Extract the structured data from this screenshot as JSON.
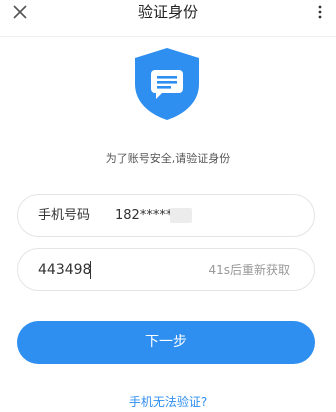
{
  "header": {
    "title": "验证身份",
    "close_icon": "close-icon",
    "more_icon": "more-vertical-icon"
  },
  "shield": {
    "icon": "shield-message-icon",
    "color": "#2f8ff0"
  },
  "hint_text": "为了账号安全,请验证身份",
  "phone_field": {
    "label": "手机号码",
    "value": "182*****"
  },
  "code_field": {
    "value": "443498",
    "resend_text": "41s后重新获取"
  },
  "next_button": {
    "label": "下一步"
  },
  "cant_verify_link": "手机无法验证?",
  "colors": {
    "accent": "#2f8ff0",
    "border": "#e4e4e4",
    "muted": "#999999"
  }
}
